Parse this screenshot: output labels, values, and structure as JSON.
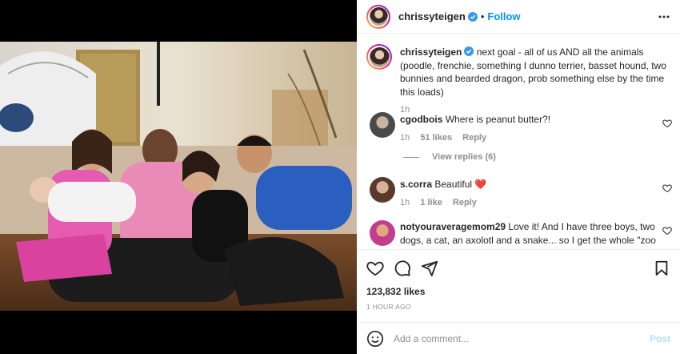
{
  "post": {
    "username": "chrissyteigen",
    "separator": "•",
    "follow_label": "Follow",
    "caption_username": "chrissyteigen",
    "caption_text": "next goal - all of us AND all the animals (poodle, frenchie, something I dunno terrier, basset hound, two bunnies and bearded dragon, prob something else by the time this loads)",
    "caption_time": "1h"
  },
  "comments": [
    {
      "username": "cgodbois",
      "text": "Where is peanut butter?!",
      "time": "1h",
      "likes": "51 likes",
      "reply": "Reply"
    },
    {
      "username": "s.corra",
      "text": "Beautiful",
      "emoji": "❤️",
      "time": "1h",
      "likes": "1 like",
      "reply": "Reply"
    },
    {
      "username": "notyouraveragemom29",
      "text": "Love it! And I have three boys, two dogs, a cat, an axolotl and a snake... so I get the whole \"zoo"
    }
  ],
  "view_replies": "View replies (6)",
  "likes_count": "123,832 likes",
  "posted_time": "1 HOUR AGO",
  "add_comment": {
    "placeholder": "Add a comment...",
    "post_label": "Post"
  },
  "icons": {
    "verified": "verified-badge-icon",
    "more": "more-options-icon",
    "like": "heart-icon",
    "comment": "comment-icon",
    "share": "share-icon",
    "save": "bookmark-icon",
    "emoji": "emoji-icon"
  },
  "colors": {
    "accent": "#0095f6",
    "text": "#262626",
    "muted": "#8e8e8e",
    "heart_red": "#ed4956"
  }
}
